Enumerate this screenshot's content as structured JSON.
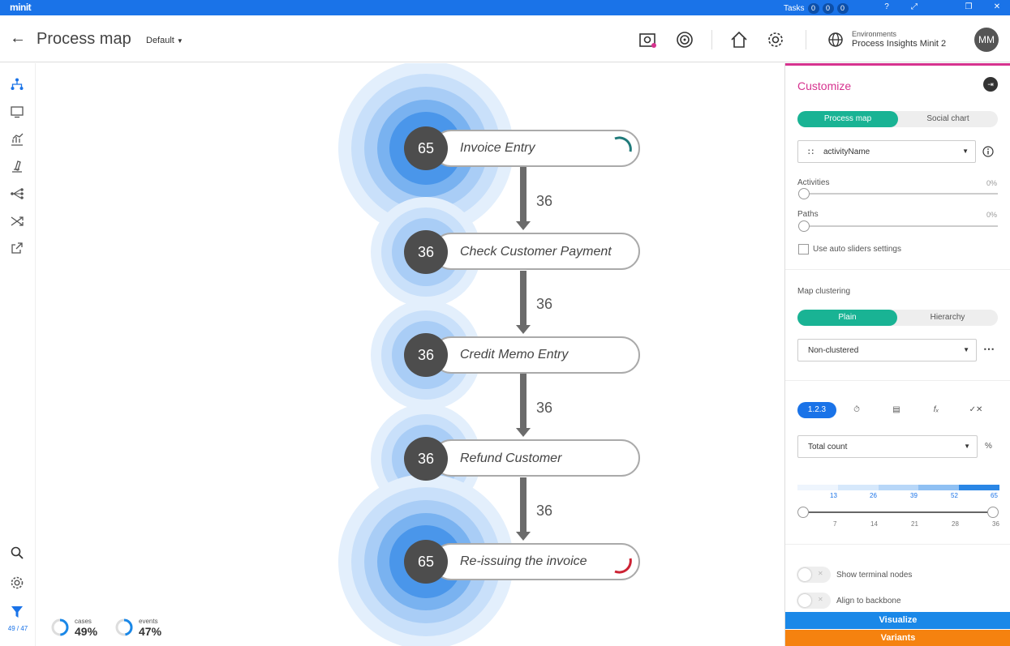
{
  "app": {
    "logo": "minit"
  },
  "topbar": {
    "tasks_label": "Tasks",
    "task_counts": [
      "0",
      "0",
      "0"
    ],
    "help": "?",
    "controls": [
      "⤢",
      "❐",
      "✕"
    ]
  },
  "header": {
    "title": "Process map",
    "view": "Default",
    "env_label": "Environments",
    "env_name": "Process Insights Minit 2",
    "avatar": "MM"
  },
  "process": {
    "nodes": [
      {
        "count": "65",
        "label": "Invoice Entry"
      },
      {
        "count": "36",
        "label": "Check Customer Payment"
      },
      {
        "count": "36",
        "label": "Credit Memo Entry"
      },
      {
        "count": "36",
        "label": "Refund Customer"
      },
      {
        "count": "65",
        "label": "Re-issuing the invoice"
      }
    ],
    "edges": [
      "36",
      "36",
      "36",
      "36"
    ]
  },
  "stats": {
    "cases_label": "cases",
    "cases_value": "49%",
    "cases_fraction": 0.49,
    "events_label": "events",
    "events_value": "47%",
    "events_fraction": 0.47
  },
  "sidebar": {
    "filter_count": "49 / 47"
  },
  "panel": {
    "title": "Customize",
    "tabs": [
      "Process map",
      "Social chart"
    ],
    "attribute": "activityName",
    "activities_label": "Activities",
    "activities_pct": "0%",
    "paths_label": "Paths",
    "paths_pct": "0%",
    "auto_sliders": "Use auto sliders settings",
    "clustering_label": "Map clustering",
    "clustering_tabs": [
      "Plain",
      "Hierarchy"
    ],
    "clustering_value": "Non-clustered",
    "metric_active": "1.2.3",
    "metric_select": "Total count",
    "metric_unit": "%",
    "scale_top": [
      "13",
      "26",
      "39",
      "52",
      "65"
    ],
    "scale_bottom": [
      "7",
      "14",
      "21",
      "28",
      "36"
    ],
    "terminal_nodes": "Show terminal nodes",
    "align_backbone": "Align to backbone",
    "visualize": "Visualize",
    "variants": "Variants"
  },
  "colors": {
    "topbar": "#1a73e8",
    "accent_pink": "#d6338f",
    "teal": "#19b394",
    "visualize": "#1a88e8",
    "variants": "#f5820f"
  }
}
